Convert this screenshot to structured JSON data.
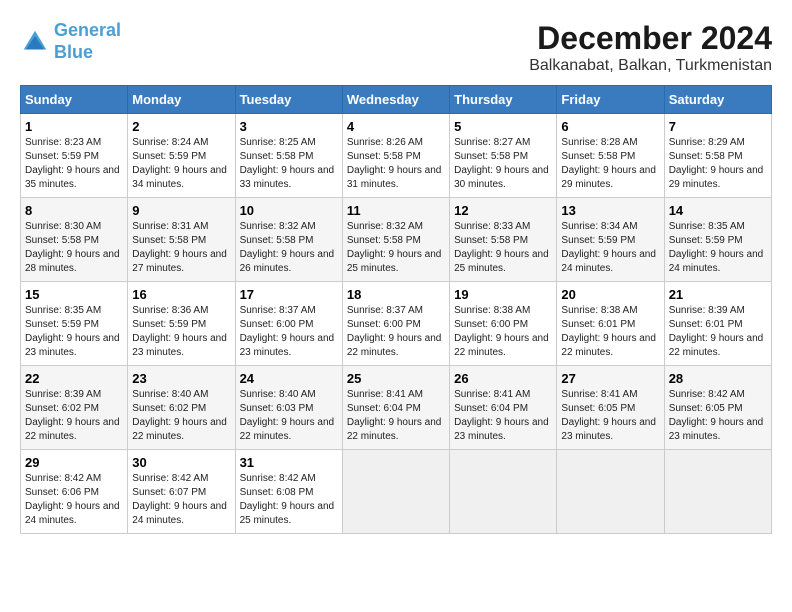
{
  "logo": {
    "line1": "General",
    "line2": "Blue"
  },
  "title": "December 2024",
  "subtitle": "Balkanabat, Balkan, Turkmenistan",
  "header_days": [
    "Sunday",
    "Monday",
    "Tuesday",
    "Wednesday",
    "Thursday",
    "Friday",
    "Saturday"
  ],
  "weeks": [
    [
      {
        "day": "1",
        "sunrise": "8:23 AM",
        "sunset": "5:59 PM",
        "daylight": "9 hours and 35 minutes."
      },
      {
        "day": "2",
        "sunrise": "8:24 AM",
        "sunset": "5:59 PM",
        "daylight": "9 hours and 34 minutes."
      },
      {
        "day": "3",
        "sunrise": "8:25 AM",
        "sunset": "5:58 PM",
        "daylight": "9 hours and 33 minutes."
      },
      {
        "day": "4",
        "sunrise": "8:26 AM",
        "sunset": "5:58 PM",
        "daylight": "9 hours and 31 minutes."
      },
      {
        "day": "5",
        "sunrise": "8:27 AM",
        "sunset": "5:58 PM",
        "daylight": "9 hours and 30 minutes."
      },
      {
        "day": "6",
        "sunrise": "8:28 AM",
        "sunset": "5:58 PM",
        "daylight": "9 hours and 29 minutes."
      },
      {
        "day": "7",
        "sunrise": "8:29 AM",
        "sunset": "5:58 PM",
        "daylight": "9 hours and 29 minutes."
      }
    ],
    [
      {
        "day": "8",
        "sunrise": "8:30 AM",
        "sunset": "5:58 PM",
        "daylight": "9 hours and 28 minutes."
      },
      {
        "day": "9",
        "sunrise": "8:31 AM",
        "sunset": "5:58 PM",
        "daylight": "9 hours and 27 minutes."
      },
      {
        "day": "10",
        "sunrise": "8:32 AM",
        "sunset": "5:58 PM",
        "daylight": "9 hours and 26 minutes."
      },
      {
        "day": "11",
        "sunrise": "8:32 AM",
        "sunset": "5:58 PM",
        "daylight": "9 hours and 25 minutes."
      },
      {
        "day": "12",
        "sunrise": "8:33 AM",
        "sunset": "5:58 PM",
        "daylight": "9 hours and 25 minutes."
      },
      {
        "day": "13",
        "sunrise": "8:34 AM",
        "sunset": "5:59 PM",
        "daylight": "9 hours and 24 minutes."
      },
      {
        "day": "14",
        "sunrise": "8:35 AM",
        "sunset": "5:59 PM",
        "daylight": "9 hours and 24 minutes."
      }
    ],
    [
      {
        "day": "15",
        "sunrise": "8:35 AM",
        "sunset": "5:59 PM",
        "daylight": "9 hours and 23 minutes."
      },
      {
        "day": "16",
        "sunrise": "8:36 AM",
        "sunset": "5:59 PM",
        "daylight": "9 hours and 23 minutes."
      },
      {
        "day": "17",
        "sunrise": "8:37 AM",
        "sunset": "6:00 PM",
        "daylight": "9 hours and 23 minutes."
      },
      {
        "day": "18",
        "sunrise": "8:37 AM",
        "sunset": "6:00 PM",
        "daylight": "9 hours and 22 minutes."
      },
      {
        "day": "19",
        "sunrise": "8:38 AM",
        "sunset": "6:00 PM",
        "daylight": "9 hours and 22 minutes."
      },
      {
        "day": "20",
        "sunrise": "8:38 AM",
        "sunset": "6:01 PM",
        "daylight": "9 hours and 22 minutes."
      },
      {
        "day": "21",
        "sunrise": "8:39 AM",
        "sunset": "6:01 PM",
        "daylight": "9 hours and 22 minutes."
      }
    ],
    [
      {
        "day": "22",
        "sunrise": "8:39 AM",
        "sunset": "6:02 PM",
        "daylight": "9 hours and 22 minutes."
      },
      {
        "day": "23",
        "sunrise": "8:40 AM",
        "sunset": "6:02 PM",
        "daylight": "9 hours and 22 minutes."
      },
      {
        "day": "24",
        "sunrise": "8:40 AM",
        "sunset": "6:03 PM",
        "daylight": "9 hours and 22 minutes."
      },
      {
        "day": "25",
        "sunrise": "8:41 AM",
        "sunset": "6:04 PM",
        "daylight": "9 hours and 22 minutes."
      },
      {
        "day": "26",
        "sunrise": "8:41 AM",
        "sunset": "6:04 PM",
        "daylight": "9 hours and 23 minutes."
      },
      {
        "day": "27",
        "sunrise": "8:41 AM",
        "sunset": "6:05 PM",
        "daylight": "9 hours and 23 minutes."
      },
      {
        "day": "28",
        "sunrise": "8:42 AM",
        "sunset": "6:05 PM",
        "daylight": "9 hours and 23 minutes."
      }
    ],
    [
      {
        "day": "29",
        "sunrise": "8:42 AM",
        "sunset": "6:06 PM",
        "daylight": "9 hours and 24 minutes."
      },
      {
        "day": "30",
        "sunrise": "8:42 AM",
        "sunset": "6:07 PM",
        "daylight": "9 hours and 24 minutes."
      },
      {
        "day": "31",
        "sunrise": "8:42 AM",
        "sunset": "6:08 PM",
        "daylight": "9 hours and 25 minutes."
      },
      null,
      null,
      null,
      null
    ]
  ]
}
